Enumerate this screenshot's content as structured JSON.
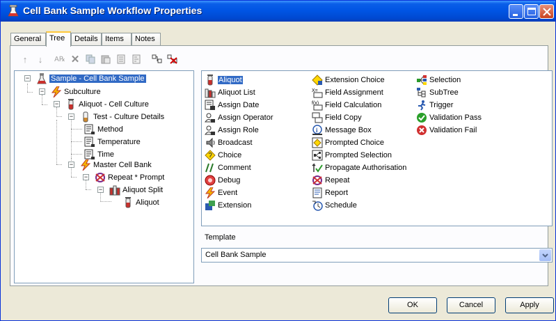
{
  "window": {
    "title": "Cell Bank Sample Workflow Properties"
  },
  "tabs": [
    "General",
    "Tree",
    "Details",
    "Items",
    "Notes"
  ],
  "active_tab": "Tree",
  "toolbar": {
    "icons": [
      "move-up-icon",
      "move-down-icon",
      "rename-icon",
      "delete-icon",
      "copy-icon",
      "paste-icon",
      "properties-icon",
      "properties-alt-icon",
      "expand-all-icon",
      "delete-branch-icon"
    ]
  },
  "tree": {
    "nodes": [
      {
        "label": "Sample - Cell Bank Sample",
        "icon": "sample-flask-icon",
        "selected": true
      },
      {
        "label": "Subculture",
        "icon": "event-bolt-icon"
      },
      {
        "label": "Aliquot - Cell Culture",
        "icon": "aliquot-tube-icon"
      },
      {
        "label": "Test - Culture Details",
        "icon": "test-tube-icon"
      },
      {
        "label": "Method",
        "icon": "assign-icon"
      },
      {
        "label": "Temperature",
        "icon": "assign-icon"
      },
      {
        "label": "Time",
        "icon": "assign-icon"
      },
      {
        "label": "Master Cell Bank",
        "icon": "event-bolt-icon"
      },
      {
        "label": "Repeat * Prompt",
        "icon": "repeat-icon"
      },
      {
        "label": "Aliquot Split",
        "icon": "aliquot-split-icon"
      },
      {
        "label": "Aliquot",
        "icon": "aliquot-tube-icon"
      }
    ]
  },
  "palette": {
    "col1": [
      "Aliquot",
      "Aliquot List",
      "Assign Date",
      "Assign Operator",
      "Assign Role",
      "Broadcast",
      "Choice",
      "Comment",
      "Debug",
      "Event",
      "Extension"
    ],
    "col2": [
      "Extension Choice",
      "Field Assignment",
      "Field Calculation",
      "Field Copy",
      "Message Box",
      "Prompted Choice",
      "Prompted Selection",
      "Propagate Authorisation",
      "Repeat",
      "Report",
      "Schedule"
    ],
    "col3": [
      "Selection",
      "SubTree",
      "Trigger",
      "Validation Pass",
      "Validation Fail"
    ],
    "selected": "Aliquot"
  },
  "template": {
    "label": "Template",
    "value": "Cell Bank Sample"
  },
  "buttons": {
    "ok": "OK",
    "cancel": "Cancel",
    "apply": "Apply"
  },
  "colors": {
    "title_bar": "#0054e3",
    "selection": "#316ac5",
    "window_bg": "#ece9d8"
  }
}
